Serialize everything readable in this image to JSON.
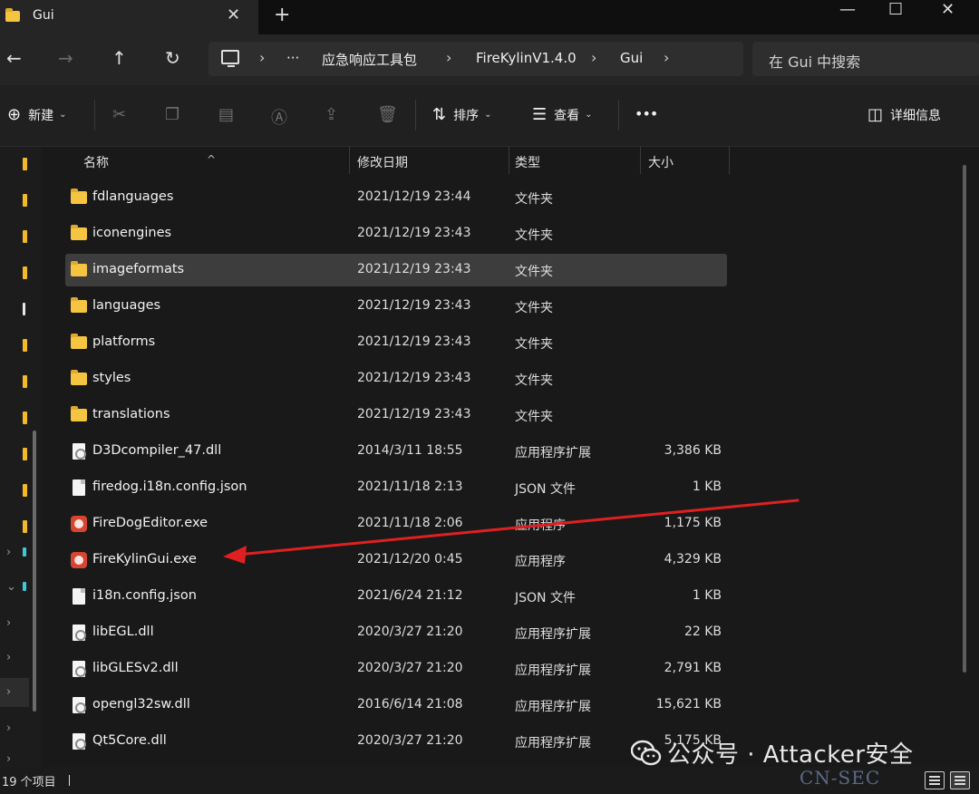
{
  "tab": {
    "title": "Gui",
    "close_glyph": "✕",
    "new_tab_glyph": "+"
  },
  "window_controls": {
    "minimize": "—",
    "maximize": "☐",
    "close": "✕"
  },
  "nav": {
    "back": "←",
    "forward": "→",
    "up": "↑",
    "refresh": "↻"
  },
  "breadcrumb": {
    "sep": "›",
    "overflow": "···",
    "items": [
      "应急响应工具包",
      "FireKylinV1.4.0",
      "Gui"
    ]
  },
  "search": {
    "placeholder": "在 Gui 中搜索"
  },
  "toolbar": {
    "new_label": "新建",
    "sort_label": "排序",
    "view_label": "查看",
    "more_label": "•••",
    "details_label": "详细信息"
  },
  "columns": {
    "name": "名称",
    "date": "修改日期",
    "type": "类型",
    "size": "大小"
  },
  "files": [
    {
      "name": "fdlanguages",
      "date": "2021/12/19 23:44",
      "type": "文件夹",
      "size": "",
      "icon": "folder-icon",
      "selected": false
    },
    {
      "name": "iconengines",
      "date": "2021/12/19 23:43",
      "type": "文件夹",
      "size": "",
      "icon": "folder-icon",
      "selected": false
    },
    {
      "name": "imageformats",
      "date": "2021/12/19 23:43",
      "type": "文件夹",
      "size": "",
      "icon": "folder-icon",
      "selected": true
    },
    {
      "name": "languages",
      "date": "2021/12/19 23:43",
      "type": "文件夹",
      "size": "",
      "icon": "folder-icon",
      "selected": false
    },
    {
      "name": "platforms",
      "date": "2021/12/19 23:43",
      "type": "文件夹",
      "size": "",
      "icon": "folder-icon",
      "selected": false
    },
    {
      "name": "styles",
      "date": "2021/12/19 23:43",
      "type": "文件夹",
      "size": "",
      "icon": "folder-icon",
      "selected": false
    },
    {
      "name": "translations",
      "date": "2021/12/19 23:43",
      "type": "文件夹",
      "size": "",
      "icon": "folder-icon",
      "selected": false
    },
    {
      "name": "D3Dcompiler_47.dll",
      "date": "2014/3/11 18:55",
      "type": "应用程序扩展",
      "size": "3,386 KB",
      "icon": "dll-file-icon",
      "selected": false
    },
    {
      "name": "firedog.i18n.config.json",
      "date": "2021/11/18 2:13",
      "type": "JSON 文件",
      "size": "1 KB",
      "icon": "document-icon",
      "selected": false
    },
    {
      "name": "FireDogEditor.exe",
      "date": "2021/11/18 2:06",
      "type": "应用程序",
      "size": "1,175 KB",
      "icon": "app-icon",
      "selected": false
    },
    {
      "name": "FireKylinGui.exe",
      "date": "2021/12/20 0:45",
      "type": "应用程序",
      "size": "4,329 KB",
      "icon": "app-icon",
      "selected": false
    },
    {
      "name": "i18n.config.json",
      "date": "2021/6/24 21:12",
      "type": "JSON 文件",
      "size": "1 KB",
      "icon": "document-icon",
      "selected": false
    },
    {
      "name": "libEGL.dll",
      "date": "2020/3/27 21:20",
      "type": "应用程序扩展",
      "size": "22 KB",
      "icon": "dll-file-icon",
      "selected": false
    },
    {
      "name": "libGLESv2.dll",
      "date": "2020/3/27 21:20",
      "type": "应用程序扩展",
      "size": "2,791 KB",
      "icon": "dll-file-icon",
      "selected": false
    },
    {
      "name": "opengl32sw.dll",
      "date": "2016/6/14 21:08",
      "type": "应用程序扩展",
      "size": "15,621 KB",
      "icon": "dll-file-icon",
      "selected": false
    },
    {
      "name": "Qt5Core.dll",
      "date": "2020/3/27 21:20",
      "type": "应用程序扩展",
      "size": "5,175 KB",
      "icon": "dll-file-icon",
      "selected": false
    }
  ],
  "status": {
    "item_count": "19 个项目"
  },
  "watermark": {
    "text": "公众号 · Attacker安全",
    "site": "CN-SEC"
  },
  "colors": {
    "folder": "#f5c542",
    "nav_marker": "#f2b92b",
    "annotation_arrow": "#e02020",
    "selection": "#3d3d3d"
  }
}
